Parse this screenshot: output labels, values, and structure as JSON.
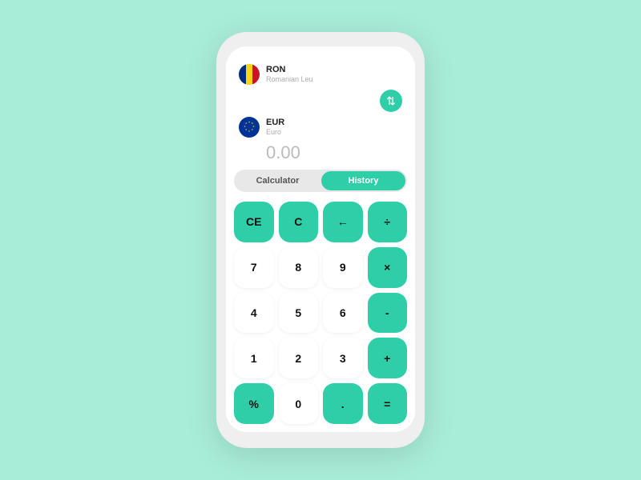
{
  "background_color": "#a8edd8",
  "phone": {
    "currencies": {
      "from": {
        "code": "RON",
        "name": "Romanian Leu",
        "amount": ""
      },
      "to": {
        "code": "EUR",
        "name": "Euro",
        "amount": "0.00"
      }
    },
    "tabs": [
      {
        "id": "calculator",
        "label": "Calculator",
        "active": false
      },
      {
        "id": "history",
        "label": "History",
        "active": true
      }
    ],
    "keypad": {
      "rows": [
        [
          "CE",
          "C",
          "←",
          "÷"
        ],
        [
          "7",
          "8",
          "9",
          "×"
        ],
        [
          "4",
          "5",
          "6",
          "-"
        ],
        [
          "1",
          "2",
          "3",
          "+"
        ],
        [
          "%",
          "0",
          ".",
          "="
        ]
      ],
      "green_keys": [
        "CE",
        "C",
        "←",
        "÷",
        "×",
        "-",
        "+",
        "%",
        ".",
        "="
      ],
      "white_keys": [
        "7",
        "8",
        "9",
        "4",
        "5",
        "6",
        "1",
        "2",
        "3",
        "0"
      ]
    },
    "swap_button_label": "⇅"
  }
}
